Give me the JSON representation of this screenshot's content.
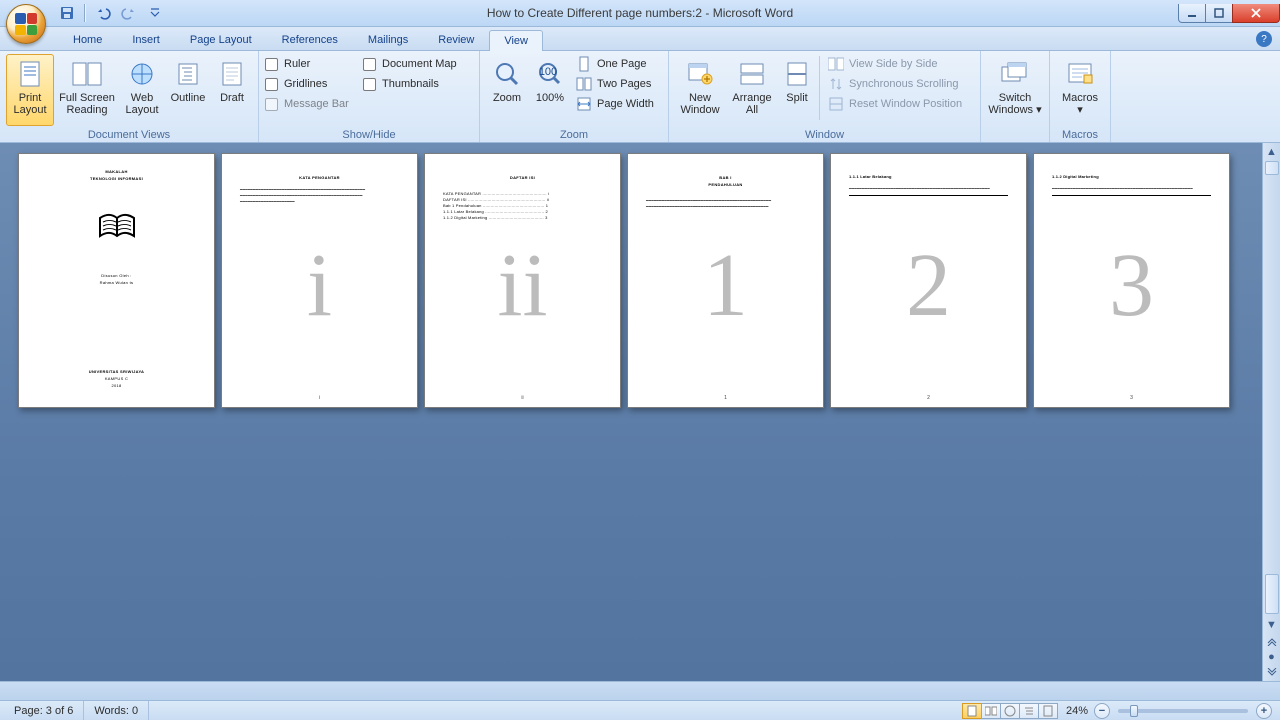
{
  "app": {
    "title": "How to Create Different page numbers:2 - Microsoft Word"
  },
  "tabs": {
    "home": "Home",
    "insert": "Insert",
    "pagelayout": "Page Layout",
    "references": "References",
    "mailings": "Mailings",
    "review": "Review",
    "view": "View"
  },
  "ribbon": {
    "docviews": {
      "label": "Document Views",
      "print": "Print Layout",
      "fullscreen": "Full Screen Reading",
      "web": "Web Layout",
      "outline": "Outline",
      "draft": "Draft"
    },
    "showhide": {
      "label": "Show/Hide",
      "ruler": "Ruler",
      "gridlines": "Gridlines",
      "msgbar": "Message Bar",
      "docmap": "Document Map",
      "thumbs": "Thumbnails"
    },
    "zoom": {
      "label": "Zoom",
      "zoom": "Zoom",
      "hundred": "100%",
      "onepage": "One Page",
      "twopages": "Two Pages",
      "pagewidth": "Page Width"
    },
    "window": {
      "label": "Window",
      "newwin": "New Window",
      "arrange": "Arrange All",
      "split": "Split",
      "sidebyside": "View Side by Side",
      "syncscroll": "Synchronous Scrolling",
      "resetpos": "Reset Window Position",
      "switch": "Switch Windows"
    },
    "macros": {
      "label": "Macros",
      "macros": "Macros"
    }
  },
  "pages": [
    {
      "title": "MAKALAH",
      "subtitle": "TEKNOLOGI INFORMASI",
      "author1": "Disusun Oleh :",
      "author2": "Rahma Wulan ts",
      "uni": "UNIVERSITAS SRIWIJAYA",
      "city": "KAMPUS C",
      "year": "2018",
      "foot": ""
    },
    {
      "heading": "KATA PENGANTAR",
      "foot": "i",
      "big": "i",
      "lines": [
        "",
        "",
        ""
      ]
    },
    {
      "heading": "DAFTAR ISI",
      "foot": "ii",
      "big": "ii",
      "toc": [
        "KATA PENGANTAR ................................................. i",
        "DAFTAR ISI ........................................................... ii",
        "Bab 1  Pendahuluan ............................................... 1",
        " 1.1.1  Latar Belakang ............................................. 2",
        " 1.1.2  Digital Marketing .......................................... 3"
      ]
    },
    {
      "heading1": "BAB I",
      "heading2": "PENDAHULUAN",
      "foot": "1",
      "big": "1",
      "body": [
        "",
        ""
      ]
    },
    {
      "heading": "1.1.1  Latar Belakang",
      "foot": "2",
      "big": "2",
      "body": [
        ""
      ]
    },
    {
      "heading": "1.1.2  Digital Marketing",
      "foot": "3",
      "big": "3",
      "body": [
        ""
      ]
    }
  ],
  "status": {
    "page": "Page: 3 of 6",
    "words": "Words: 0",
    "zoom": "24%"
  }
}
